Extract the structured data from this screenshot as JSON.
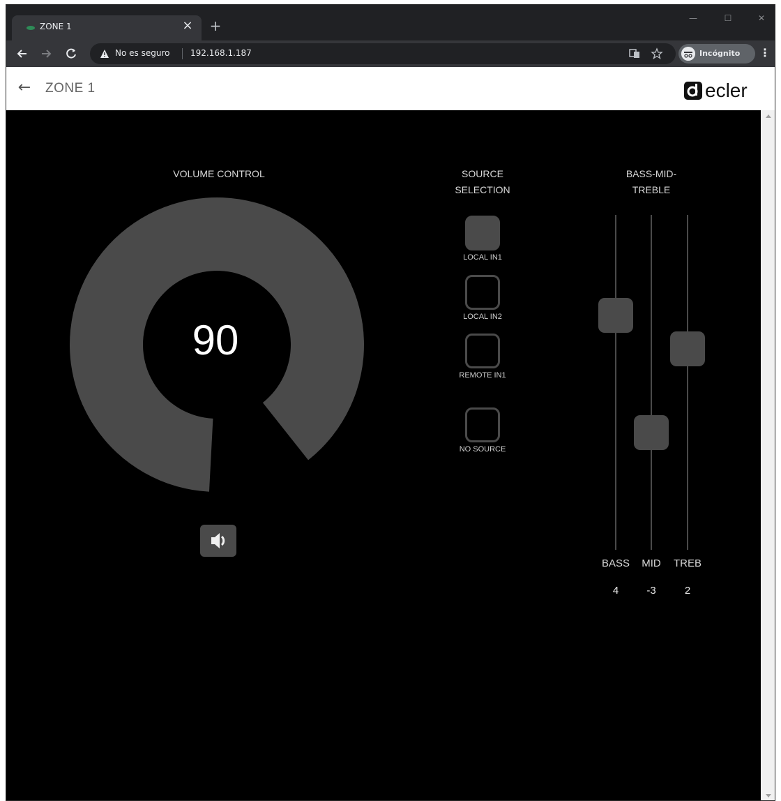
{
  "browser": {
    "tab_title": "ZONE 1",
    "tab_close": "×",
    "new_tab": "+",
    "security_label": "No es seguro",
    "url": "192.168.1.187",
    "incognito_label": "Incógnito",
    "menu": "⋮",
    "minimize": "—",
    "maximize": "☐",
    "close": "✕"
  },
  "header": {
    "back": "←",
    "title": "ZONE 1",
    "logo_text": "ecler"
  },
  "volume": {
    "title": "VOLUME CONTROL",
    "value": "90",
    "level_fraction": 0.9
  },
  "source": {
    "title_line1": "SOURCE",
    "title_line2": "SELECTION",
    "options": [
      {
        "label": "LOCAL IN1",
        "active": true
      },
      {
        "label": "LOCAL IN2",
        "active": false
      },
      {
        "label": "REMOTE IN1",
        "active": false
      },
      {
        "label": "NO SOURCE",
        "active": false
      }
    ]
  },
  "eq": {
    "title_line1": "BASS-MID-",
    "title_line2": "TREBLE",
    "range": [
      -10,
      10
    ],
    "bands": [
      {
        "label": "BASS",
        "value": "4"
      },
      {
        "label": "MID",
        "value": "-3"
      },
      {
        "label": "TREB",
        "value": "2"
      }
    ]
  },
  "colors": {
    "control_gray": "#4a4a4a",
    "background": "#000000",
    "header_bg": "#ffffff"
  }
}
